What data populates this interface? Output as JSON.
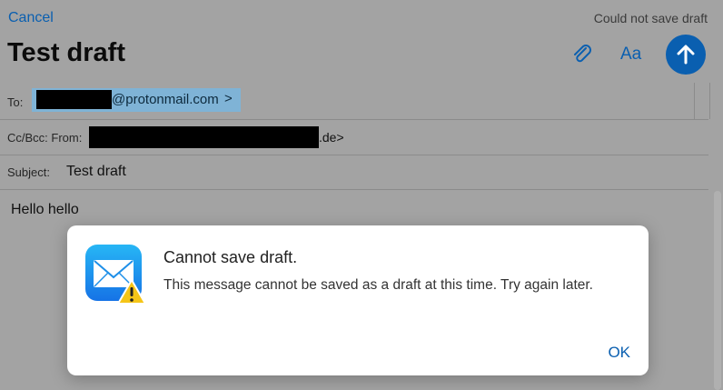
{
  "header": {
    "cancel_label": "Cancel",
    "status_text": "Could not save draft",
    "title": "Test draft",
    "font_button_label": "Aa"
  },
  "fields": {
    "to_label": "To:",
    "to_recipient_visible": "@protonmail.com",
    "to_chevron": ">",
    "cc_bcc_from_label": "Cc/Bcc: From:",
    "from_visible_tail": ".de>",
    "subject_label": "Subject:",
    "subject_value": "Test draft"
  },
  "body": {
    "text": "Hello hello"
  },
  "dialog": {
    "title": "Cannot save draft.",
    "message": "This message cannot be saved as a draft at this time. Try again later.",
    "ok_label": "OK",
    "icon": "mail-warning-icon"
  },
  "colors": {
    "accent": "#0a5fb0",
    "recipient_highlight": "#7fb3d6"
  }
}
